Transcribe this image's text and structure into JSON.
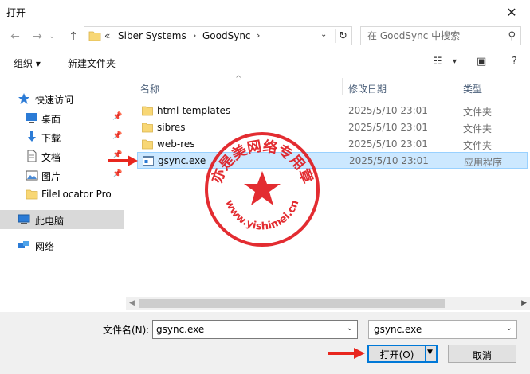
{
  "window": {
    "title": "打开"
  },
  "address": {
    "segments": [
      "Siber Systems",
      "GoodSync"
    ]
  },
  "search": {
    "placeholder": "在 GoodSync 中搜索"
  },
  "toolbar": {
    "organize": "组织 ▾",
    "new_folder": "新建文件夹"
  },
  "sidebar": {
    "items": [
      {
        "label": "快速访问",
        "icon": "star-icon"
      },
      {
        "label": "桌面",
        "icon": "desktop-icon",
        "pinned": true
      },
      {
        "label": "下载",
        "icon": "download-icon",
        "pinned": true
      },
      {
        "label": "文档",
        "icon": "document-icon",
        "pinned": true
      },
      {
        "label": "图片",
        "icon": "picture-icon",
        "pinned": true
      },
      {
        "label": "FileLocator Pro",
        "icon": "folder-icon"
      },
      {
        "label": "此电脑",
        "icon": "computer-icon"
      },
      {
        "label": "网络",
        "icon": "network-icon"
      }
    ]
  },
  "columns": {
    "name": "名称",
    "date": "修改日期",
    "type": "类型"
  },
  "files": [
    {
      "name": "html-templates",
      "date": "2025/5/10 23:01",
      "type": "文件夹",
      "icon": "folder-icon"
    },
    {
      "name": "sibres",
      "date": "2025/5/10 23:01",
      "type": "文件夹",
      "icon": "folder-icon"
    },
    {
      "name": "web-res",
      "date": "2025/5/10 23:01",
      "type": "文件夹",
      "icon": "folder-icon"
    },
    {
      "name": "gsync.exe",
      "date": "2025/5/10 23:01",
      "type": "应用程序",
      "icon": "application-icon"
    }
  ],
  "bottom": {
    "filename_label": "文件名(N):",
    "filename_value": "gsync.exe",
    "filetype_value": "gsync.exe",
    "open_label": "打开(O)",
    "cancel_label": "取消"
  },
  "watermark": {
    "text": "亦是美网络专用章",
    "url": "www.yishimei.cn"
  },
  "colors": {
    "accent": "#0078d7",
    "selection": "#cce8ff",
    "folder": "#f8d775",
    "stamp": "#e0161b"
  }
}
